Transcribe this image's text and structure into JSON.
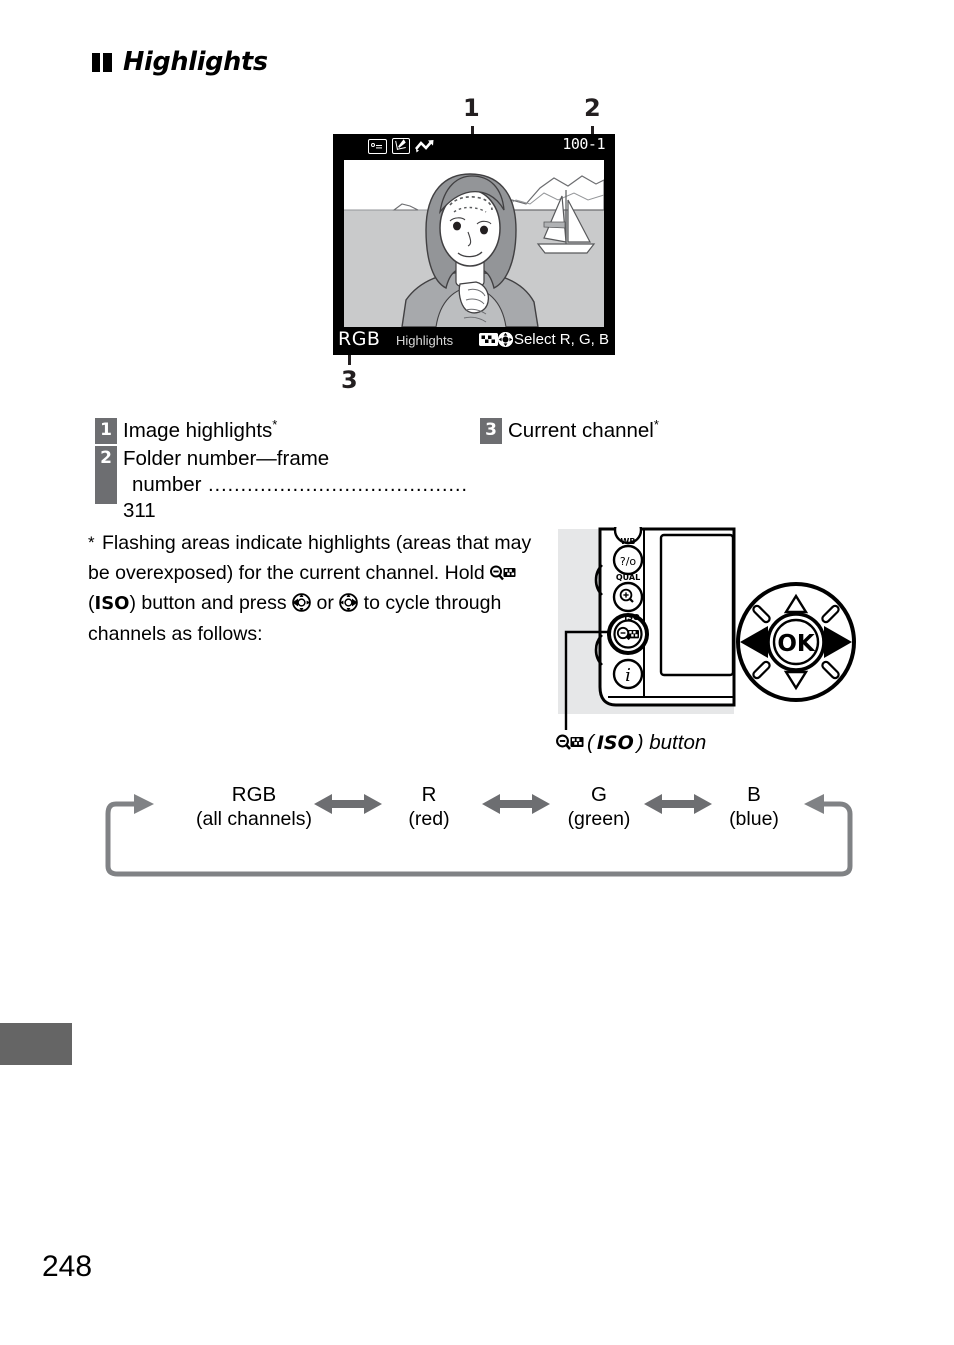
{
  "page": {
    "number": "248",
    "section_title": "Highlights"
  },
  "lcd": {
    "callouts": {
      "one": "1",
      "two": "2",
      "three": "3"
    },
    "icons": [
      "protect-icon",
      "retouch-icon",
      "zigzag-icon"
    ],
    "frame_number": "100-1",
    "channel_label": "RGB",
    "mode_label": "Highlights",
    "select_hint": "Select R, G, B",
    "hint_icons": [
      "thumbnail-zoom-out-icon",
      "multi-selector-icon"
    ]
  },
  "legend": {
    "left": [
      {
        "num": "1",
        "text": "Image highlights",
        "star": "*",
        "dots": "",
        "page": ""
      },
      {
        "num": "2",
        "text": "Folder number—frame",
        "star": "",
        "line2": "number",
        "dots": " ........................................ ",
        "page": "311"
      }
    ],
    "right": [
      {
        "num": "3",
        "text": "Current channel",
        "star": "*"
      }
    ]
  },
  "footnote": {
    "marker": "*",
    "part1": "Flashing areas indicate highlights (areas that may be overexposed) for the current channel.  Hold ",
    "iso_label_open": " (",
    "iso_label": "ISO",
    "iso_label_close": ") button and press ",
    "part2": " or ",
    "part3": " to cycle through channels as follows:"
  },
  "camera_figure": {
    "buttons": [
      {
        "name": "wb-button",
        "label": "WB",
        "glyph": "?/o-n"
      },
      {
        "name": "qual-button",
        "label": "QUAL",
        "glyph": "zoom-in"
      },
      {
        "name": "iso-button",
        "label": "ISO",
        "glyph": "zoom-out-thumbnail"
      },
      {
        "name": "i-button",
        "label": "",
        "glyph": "i"
      }
    ],
    "multiselector_center": "OK",
    "caption_icon": "zoom-out-thumbnail-icon",
    "caption_open": "(",
    "caption_bold": "ISO",
    "caption_close": ") button"
  },
  "cycle_diagram": {
    "items": [
      {
        "channel": "RGB",
        "name": "(all channels)"
      },
      {
        "channel": "R",
        "name": "(red)"
      },
      {
        "channel": "G",
        "name": "(green)"
      },
      {
        "channel": "B",
        "name": "(blue)"
      }
    ],
    "loop_color": "#808285",
    "arrow_color": "#6d6e71"
  }
}
